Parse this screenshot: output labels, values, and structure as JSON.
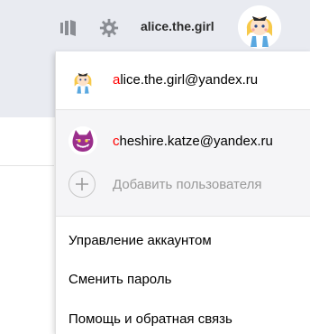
{
  "header": {
    "username": "alice.the.girl",
    "icons": [
      "books-icon",
      "gear-icon"
    ]
  },
  "accounts": {
    "current": {
      "email_first": "a",
      "email_rest": "lice.the.girl@yandex.ru",
      "avatar": "alice-avatar"
    },
    "others": [
      {
        "email_first": "c",
        "email_rest": "heshire.katze@yandex.ru",
        "avatar": "cheshire-cat-avatar"
      }
    ],
    "add_user_label": "Добавить пользователя"
  },
  "menu": {
    "items": [
      "Управление аккаунтом",
      "Сменить пароль",
      "Помощь и обратная связь"
    ]
  },
  "colors": {
    "header_bg": "#e9ebf1",
    "email_first_letter": "#ff0000",
    "others_bg": "#f5f5f7",
    "add_label": "#999999"
  }
}
